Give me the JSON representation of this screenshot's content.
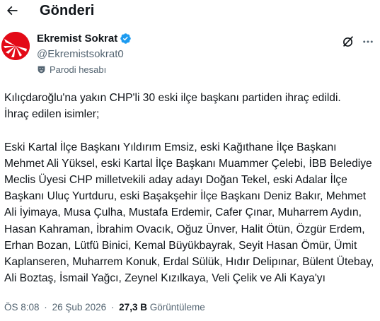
{
  "header": {
    "back_icon": "arrow-left-icon",
    "title": "Gönderi"
  },
  "author": {
    "name": "Ekremist Sokrat",
    "handle": "@Ekremistsokrat0",
    "verified": true,
    "verified_color": "#1d9bf0",
    "parody_label": "Parodi hesabı",
    "avatar_color": "#e30a17"
  },
  "actions": {
    "grok_icon": "grok-icon",
    "more_icon": "more-horizontal-icon"
  },
  "tweet": {
    "text": "Kılıçdaroğlu'na yakın CHP'li 30 eski ilçe başkanı partiden ihraç edildi.\nİhraç edilen isimler;\n\nEski Kartal İlçe Başkanı Yıldırım Emsiz, eski Kağıthane İlçe Başkanı Mehmet Ali Yüksel, eski Kartal İlçe Başkanı Muammer Çelebi, İBB Belediye Meclis Üyesi CHP milletvekili aday adayı Doğan Tekel, eski Adalar İlçe Başkanı Uluç Yurtduru, eski Başakşehir İlçe Başkanı Deniz Bakır, Mehmet Ali İyimaya, Musa Çulha, Mustafa Erdemir, Cafer Çınar, Muharrem Aydın, Hasan Kahraman, İbrahim Ovacık, Oğuz Ünver, Halit Ötün, Özgür Erdem, Erhan Bozan, Lütfü Binici, Kemal Büyükbayrak, Seyit Hasan Ömür, Ümit Kaplanseren, Muharrem Konuk, Erdal Sülük, Hıdır Delipınar, Bülent Ütebay, Ali Boztaş, İsmail Yağcı, Zeynel Kızılkaya, Veli Çelik ve Ali Kaya'yı"
  },
  "meta": {
    "time": "ÖS 8:08",
    "separator": "·",
    "date": "26 Şub 2026",
    "views_count": "27,3 B",
    "views_label": "Görüntüleme"
  }
}
